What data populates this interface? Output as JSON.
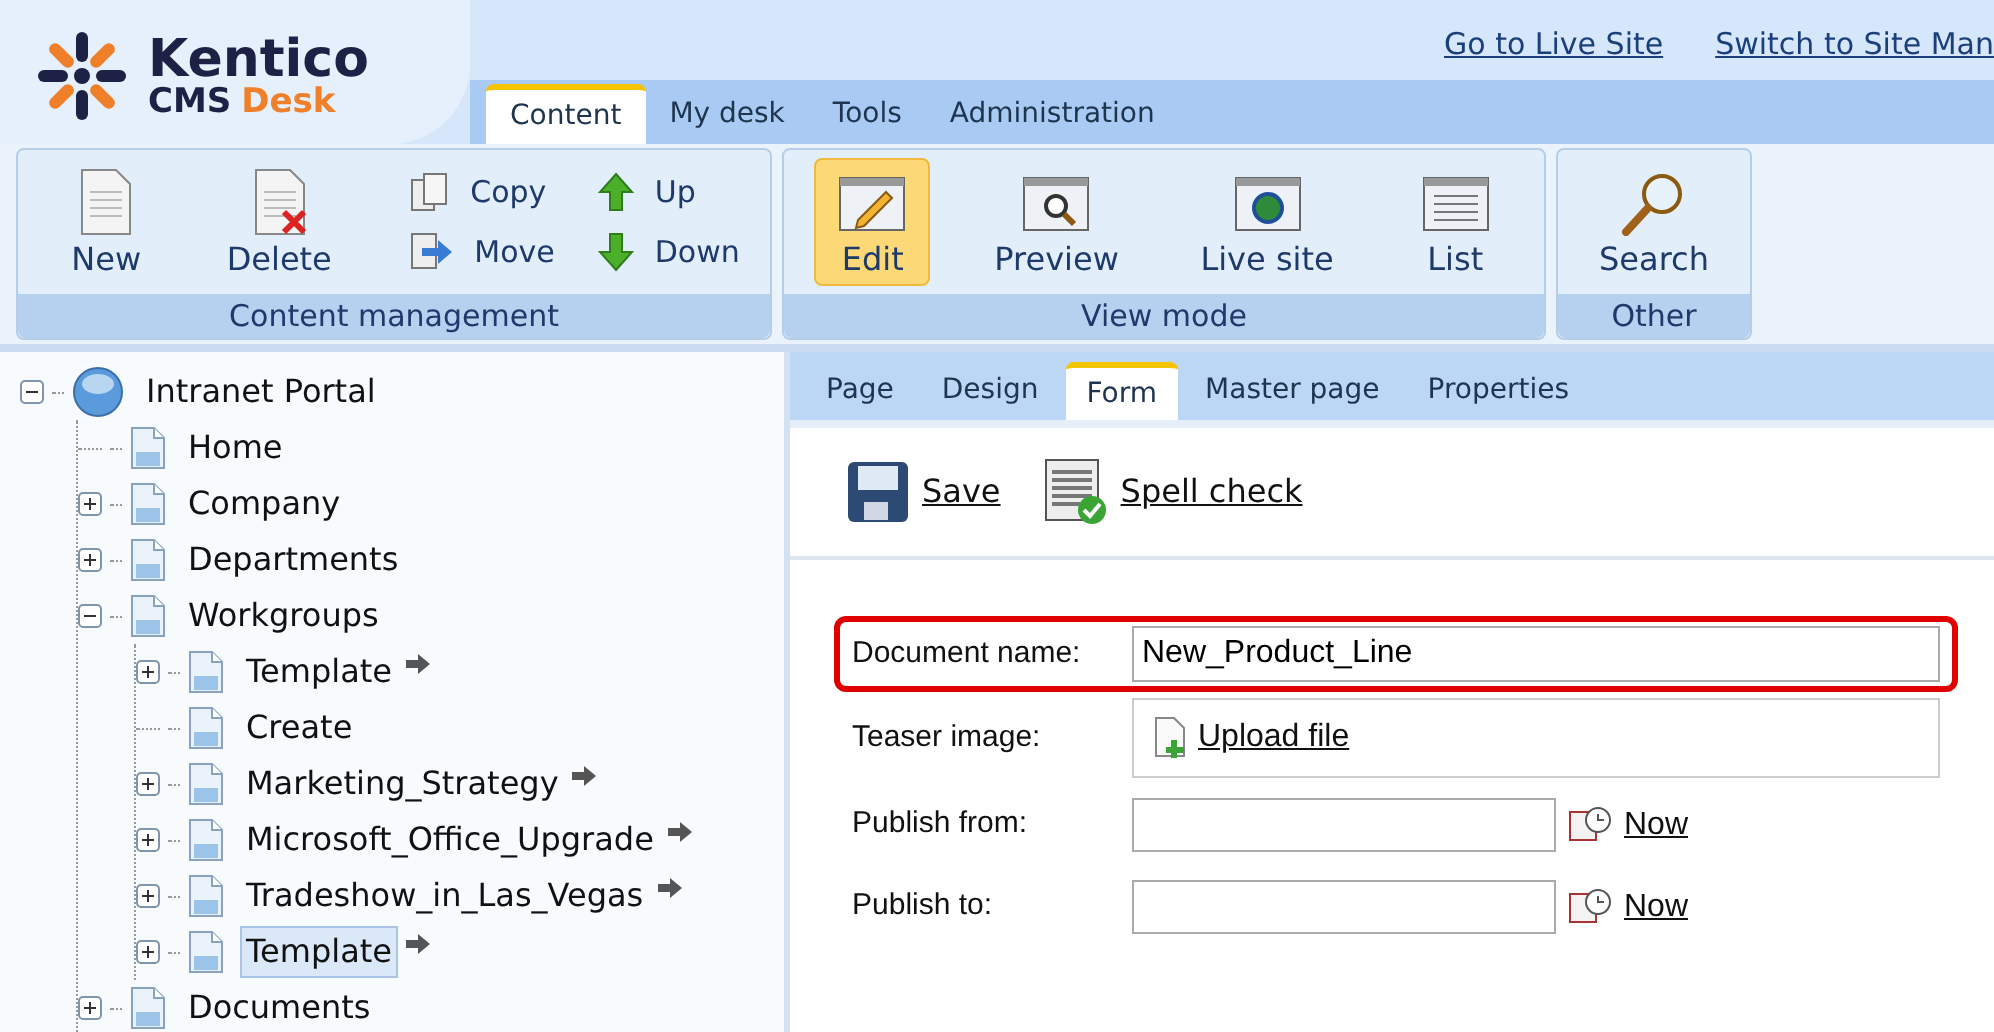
{
  "logo": {
    "name": "Kentico",
    "product": "CMS",
    "product_accent": "Desk"
  },
  "top_links": [
    "Go to Live Site",
    "Switch to Site Man"
  ],
  "main_tabs": [
    {
      "label": "Content",
      "selected": true
    },
    {
      "label": "My desk",
      "selected": false
    },
    {
      "label": "Tools",
      "selected": false
    },
    {
      "label": "Administration",
      "selected": false
    }
  ],
  "toolbar_groups": [
    {
      "title": "Content management",
      "buttons": [
        {
          "label": "New",
          "kind": "large",
          "selected": false
        },
        {
          "label": "Delete",
          "kind": "large",
          "selected": false
        },
        {
          "label": "Copy",
          "kind": "small",
          "selected": false
        },
        {
          "label": "Move",
          "kind": "small",
          "selected": false
        },
        {
          "label": "Up",
          "kind": "small",
          "selected": false
        },
        {
          "label": "Down",
          "kind": "small",
          "selected": false
        }
      ]
    },
    {
      "title": "View mode",
      "buttons": [
        {
          "label": "Edit",
          "kind": "large",
          "selected": true
        },
        {
          "label": "Preview",
          "kind": "large",
          "selected": false
        },
        {
          "label": "Live site",
          "kind": "large",
          "selected": false
        },
        {
          "label": "List",
          "kind": "large",
          "selected": false
        }
      ]
    },
    {
      "title": "Other",
      "buttons": [
        {
          "label": "Search",
          "kind": "large",
          "selected": false
        }
      ]
    }
  ],
  "tree": [
    {
      "label": "Intranet Portal",
      "kind": "site",
      "expanded": true,
      "linked": false,
      "selected": false,
      "children": [
        {
          "label": "Home",
          "kind": "page",
          "linked": false,
          "selected": false
        },
        {
          "label": "Company",
          "kind": "page",
          "expanded": false,
          "linked": false,
          "selected": false
        },
        {
          "label": "Departments",
          "kind": "page",
          "expanded": false,
          "linked": false,
          "selected": false
        },
        {
          "label": "Workgroups",
          "kind": "page",
          "expanded": true,
          "linked": false,
          "selected": false,
          "children": [
            {
              "label": "Template",
              "kind": "page",
              "expanded": false,
              "linked": true,
              "selected": false
            },
            {
              "label": "Create",
              "kind": "page",
              "linked": false,
              "selected": false
            },
            {
              "label": "Marketing_Strategy",
              "kind": "page",
              "expanded": false,
              "linked": true,
              "selected": false
            },
            {
              "label": "Microsoft_Office_Upgrade",
              "kind": "page",
              "expanded": false,
              "linked": true,
              "selected": false
            },
            {
              "label": "Tradeshow_in_Las_Vegas",
              "kind": "page",
              "expanded": false,
              "linked": true,
              "selected": false
            },
            {
              "label": "Template",
              "kind": "page",
              "expanded": false,
              "linked": true,
              "selected": true
            }
          ]
        },
        {
          "label": "Documents",
          "kind": "page",
          "expanded": false,
          "linked": false,
          "selected": false
        }
      ]
    }
  ],
  "page_tabs": [
    {
      "label": "Page",
      "selected": false
    },
    {
      "label": "Design",
      "selected": false
    },
    {
      "label": "Form",
      "selected": true
    },
    {
      "label": "Master page",
      "selected": false
    },
    {
      "label": "Properties",
      "selected": false
    }
  ],
  "actions": [
    {
      "label": "Save",
      "kind": "save"
    },
    {
      "label": "Spell check",
      "kind": "spell"
    }
  ],
  "form": [
    {
      "label": "Document name:",
      "kind": "text",
      "value": "New_Product_Line",
      "highlighted": true
    },
    {
      "label": "Teaser image:",
      "kind": "upload",
      "link": "Upload file",
      "highlighted": false
    },
    {
      "label": "Publish from:",
      "kind": "date",
      "link": "Now",
      "highlighted": false
    },
    {
      "label": "Publish to:",
      "kind": "date",
      "link": "Now",
      "highlighted": false
    }
  ]
}
